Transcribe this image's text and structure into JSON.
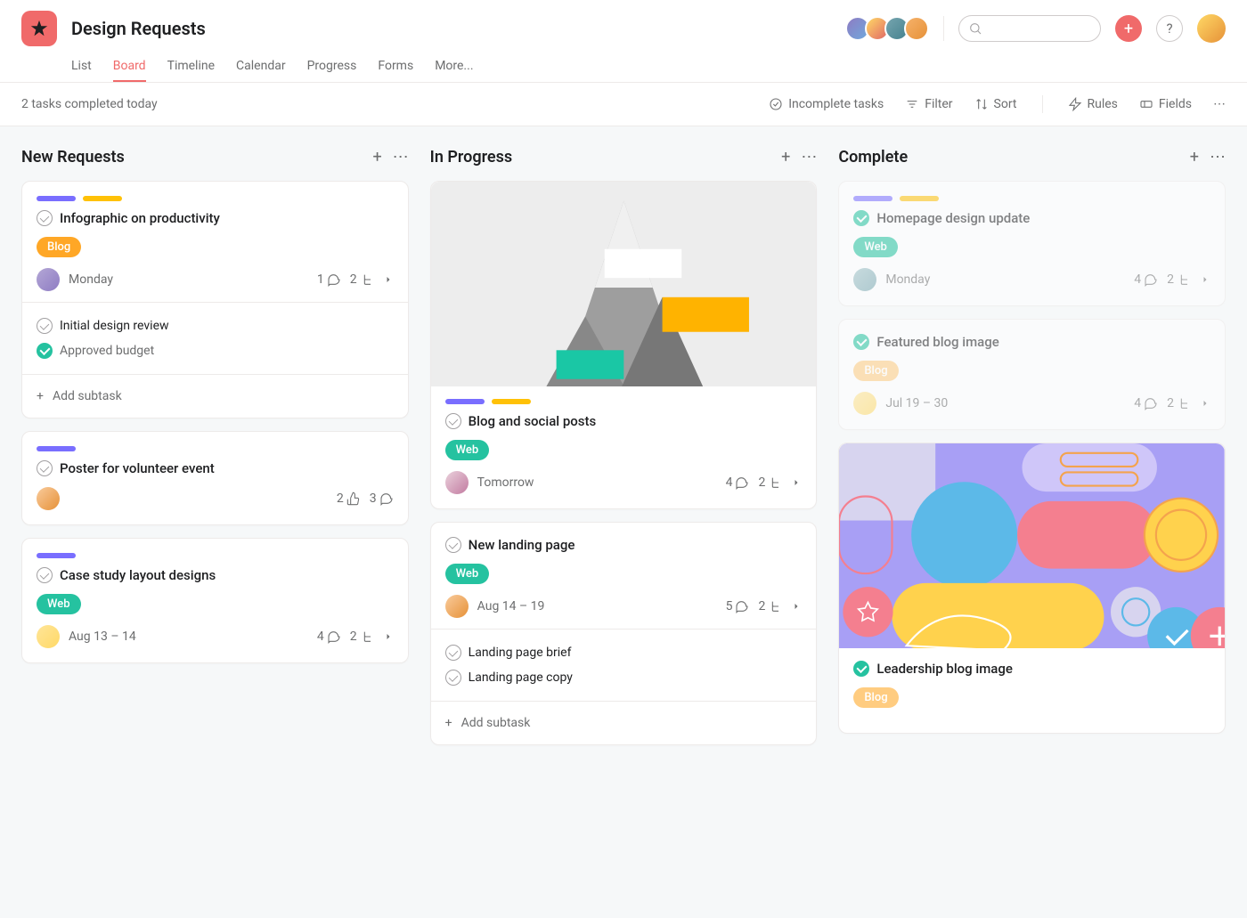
{
  "project": {
    "title": "Design Requests"
  },
  "tabs": {
    "list": "List",
    "board": "Board",
    "timeline": "Timeline",
    "calendar": "Calendar",
    "progress": "Progress",
    "forms": "Forms",
    "more": "More..."
  },
  "toolbar": {
    "status": "2 tasks completed today",
    "incomplete": "Incomplete tasks",
    "filter": "Filter",
    "sort": "Sort",
    "rules": "Rules",
    "fields": "Fields"
  },
  "columns": {
    "new": {
      "title": "New Requests"
    },
    "progress": {
      "title": "In Progress"
    },
    "complete": {
      "title": "Complete"
    }
  },
  "cards": {
    "info": {
      "title": "Infographic on productivity",
      "label": "Blog",
      "due": "Monday",
      "comments": "1",
      "subtasks_count": "2",
      "sub1": "Initial design review",
      "sub2": "Approved budget",
      "add": "Add subtask"
    },
    "poster": {
      "title": "Poster for volunteer event",
      "likes": "2",
      "comments": "3"
    },
    "case": {
      "title": "Case study layout designs",
      "label": "Web",
      "due": "Aug 13 – 14",
      "comments": "4",
      "subtasks_count": "2"
    },
    "blog": {
      "title": "Blog and social posts",
      "label": "Web",
      "due": "Tomorrow",
      "comments": "4",
      "subtasks_count": "2"
    },
    "landing": {
      "title": "New landing page",
      "label": "Web",
      "due": "Aug 14 – 19",
      "comments": "5",
      "subtasks_count": "2",
      "sub1": "Landing page brief",
      "sub2": "Landing page copy",
      "add": "Add subtask"
    },
    "homepage": {
      "title": "Homepage design update",
      "label": "Web",
      "due": "Monday",
      "comments": "4",
      "subtasks_count": "2"
    },
    "featured": {
      "title": "Featured blog image",
      "label": "Blog",
      "due": "Jul 19 – 30",
      "comments": "4",
      "subtasks_count": "2"
    },
    "leadership": {
      "title": "Leadership blog image",
      "label": "Blog"
    }
  }
}
